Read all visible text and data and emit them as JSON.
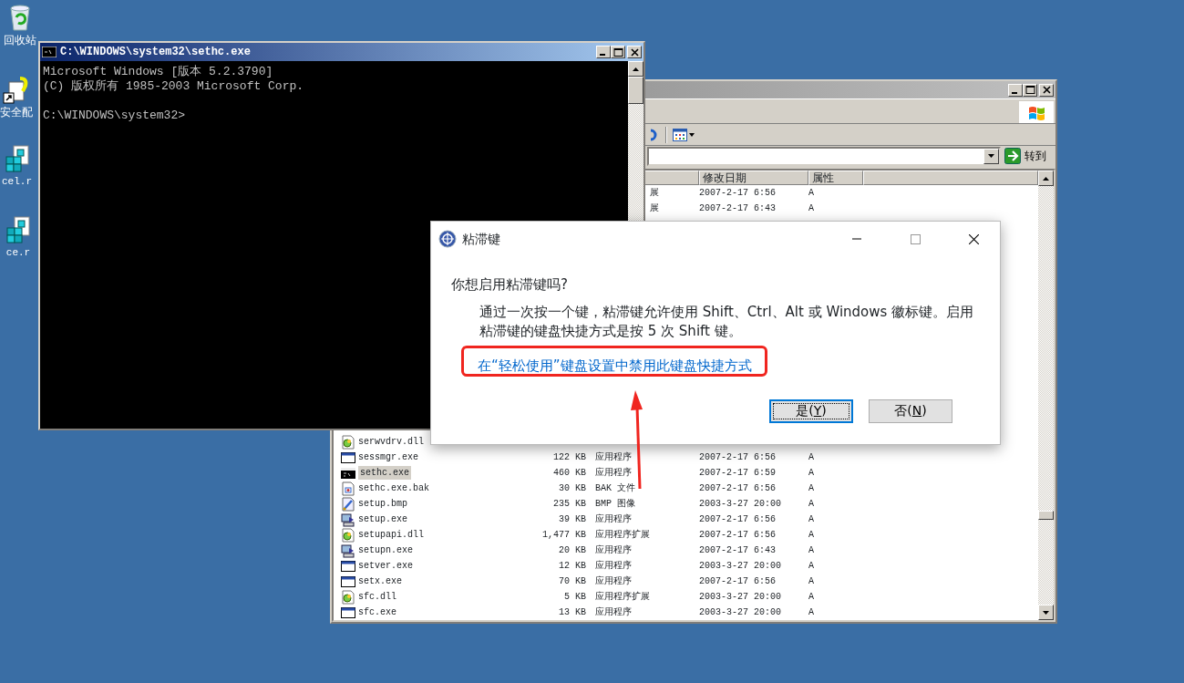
{
  "desktop": {
    "icons": [
      {
        "label": "回收站",
        "kind": "recycle"
      },
      {
        "label": "安全配",
        "kind": "shortcut"
      },
      {
        "label": "cel.r",
        "kind": "registry"
      },
      {
        "label": "ce.r",
        "kind": "registry"
      }
    ]
  },
  "explorer": {
    "go_button": "转到",
    "columns": [
      "修改日期",
      "属性"
    ],
    "top_rows": [
      {
        "type": "展",
        "modified": "2007-2-17 6:56",
        "attr": "A"
      },
      {
        "type": "展",
        "modified": "2007-2-17 6:43",
        "attr": "A"
      }
    ],
    "rows": [
      {
        "name": "serwvdrv.dll",
        "kind": "dll",
        "selected": false
      },
      {
        "name": "sessmgr.exe",
        "kind": "exe",
        "size": "122 KB",
        "type": "应用程序",
        "modified": "2007-2-17 6:56",
        "attr": "A",
        "selected": false
      },
      {
        "name": "sethc.exe",
        "kind": "console",
        "size": "460 KB",
        "type": "应用程序",
        "modified": "2007-2-17 6:59",
        "attr": "A",
        "selected": true
      },
      {
        "name": "sethc.exe.bak",
        "kind": "bak",
        "size": "30 KB",
        "type": "BAK 文件",
        "modified": "2007-2-17 6:56",
        "attr": "A",
        "selected": false
      },
      {
        "name": "setup.bmp",
        "kind": "bmp",
        "size": "235 KB",
        "type": "BMP 图像",
        "modified": "2003-3-27 20:00",
        "attr": "A",
        "selected": false
      },
      {
        "name": "setup.exe",
        "kind": "setup",
        "size": "39 KB",
        "type": "应用程序",
        "modified": "2007-2-17 6:56",
        "attr": "A",
        "selected": false
      },
      {
        "name": "setupapi.dll",
        "kind": "dll",
        "size": "1,477 KB",
        "type": "应用程序扩展",
        "modified": "2007-2-17 6:56",
        "attr": "A",
        "selected": false
      },
      {
        "name": "setupn.exe",
        "kind": "setup",
        "size": "20 KB",
        "type": "应用程序",
        "modified": "2007-2-17 6:43",
        "attr": "A",
        "selected": false
      },
      {
        "name": "setver.exe",
        "kind": "exe",
        "size": "12 KB",
        "type": "应用程序",
        "modified": "2003-3-27 20:00",
        "attr": "A",
        "selected": false
      },
      {
        "name": "setx.exe",
        "kind": "exe",
        "size": "70 KB",
        "type": "应用程序",
        "modified": "2007-2-17 6:56",
        "attr": "A",
        "selected": false
      },
      {
        "name": "sfc.dll",
        "kind": "dll",
        "size": "5 KB",
        "type": "应用程序扩展",
        "modified": "2003-3-27 20:00",
        "attr": "A",
        "selected": false
      },
      {
        "name": "sfc.exe",
        "kind": "exe",
        "size": "13 KB",
        "type": "应用程序",
        "modified": "2003-3-27 20:00",
        "attr": "A",
        "selected": false
      }
    ]
  },
  "console": {
    "title": "C:\\WINDOWS\\system32\\sethc.exe",
    "lines": [
      "Microsoft Windows [版本 5.2.3790]",
      "(C) 版权所有 1985-2003 Microsoft Corp."
    ],
    "prompt": "C:\\WINDOWS\\system32>"
  },
  "dialog": {
    "title": "粘滞键",
    "question": "你想启用粘滞键吗?",
    "description": "通过一次按一个键，粘滞键允许使用 Shift、Ctrl、Alt 或 Windows 徽标键。启用粘滞键的键盘快捷方式是按 5 次 Shift 键。",
    "link": "在“轻松使用”键盘设置中禁用此键盘快捷方式",
    "buttons": [
      {
        "before": "是(",
        "accel": "Y",
        "after": ")",
        "focused": true
      },
      {
        "before": "否(",
        "accel": "N",
        "after": ")",
        "focused": false
      }
    ]
  }
}
